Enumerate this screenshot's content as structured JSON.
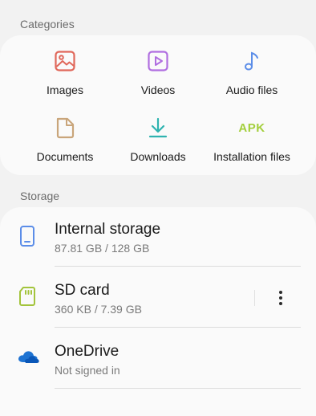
{
  "categories": {
    "title": "Categories",
    "items": [
      {
        "label": "Images",
        "icon": "image-icon",
        "color": "#e0675a"
      },
      {
        "label": "Videos",
        "icon": "video-icon",
        "color": "#b06ee0"
      },
      {
        "label": "Audio files",
        "icon": "music-note-icon",
        "color": "#5b8de8"
      },
      {
        "label": "Documents",
        "icon": "document-icon",
        "color": "#c9a57a"
      },
      {
        "label": "Downloads",
        "icon": "download-icon",
        "color": "#2fb3b0"
      },
      {
        "label": "Installation files",
        "icon": "apk-icon",
        "icon_text": "APK",
        "color": "#a3cf3c"
      }
    ]
  },
  "storage": {
    "title": "Storage",
    "items": [
      {
        "name": "Internal storage",
        "detail": "87.81 GB / 128 GB",
        "icon": "phone-icon",
        "color": "#5b8de8"
      },
      {
        "name": "SD card",
        "detail": "360 KB / 7.39 GB",
        "icon": "sd-card-icon",
        "color": "#a3c43c"
      },
      {
        "name": "OneDrive",
        "detail": "Not signed in",
        "icon": "onedrive-cloud-icon",
        "color": "#1e73d2"
      }
    ]
  }
}
